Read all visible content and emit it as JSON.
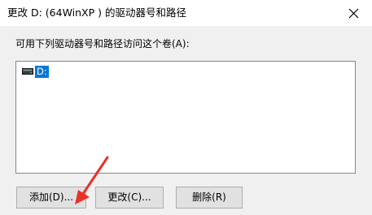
{
  "window": {
    "title": "更改 D: (64WinXP ) 的驱动器号和路径",
    "close_icon": "close-icon"
  },
  "instructions": "可用下列驱动器号和路径访问这个卷(A):",
  "drives": [
    {
      "label": "D:",
      "icon": "drive-icon",
      "selected": true
    }
  ],
  "buttons": {
    "add": "添加(D)...",
    "change": "更改(C)...",
    "remove": "删除(R)"
  },
  "annotation": {
    "arrow_color": "#e8312a",
    "points_to": "add-button"
  },
  "colors": {
    "selection": "#0078d7",
    "button_face": "#e1e1e1",
    "dialog_bg": "#f0f0f0"
  }
}
